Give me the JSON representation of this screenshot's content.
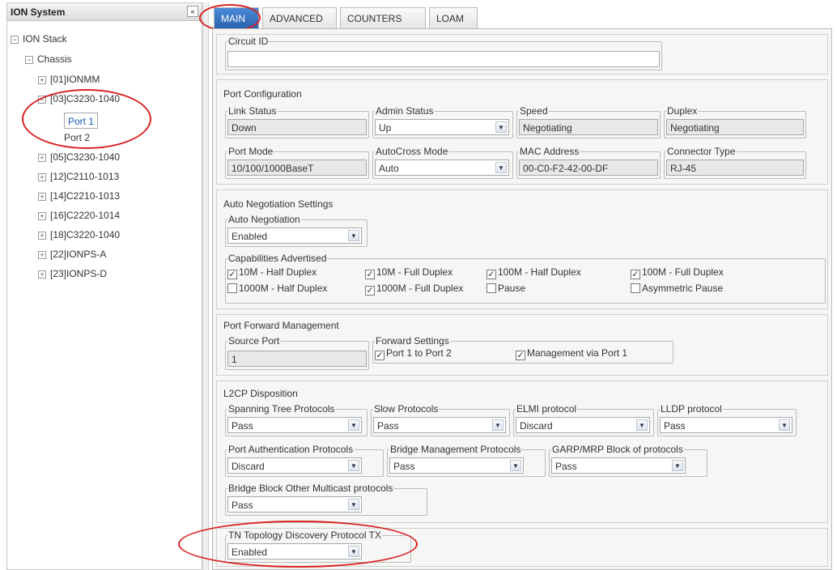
{
  "tree": {
    "title": "ION System",
    "collapse_glyph": "«",
    "nodes": [
      {
        "label": "ION Stack",
        "toggle": "−"
      },
      {
        "label": "Chassis",
        "toggle": "−"
      },
      {
        "label": "[01]IONMM",
        "toggle": "+"
      },
      {
        "label": "[03]C3230-1040",
        "toggle": "−"
      },
      {
        "label": "Port 1",
        "toggle": ""
      },
      {
        "label": "Port 2",
        "toggle": ""
      },
      {
        "label": "[05]C3230-1040",
        "toggle": "+"
      },
      {
        "label": "[12]C2110-1013",
        "toggle": "+"
      },
      {
        "label": "[14]C2210-1013",
        "toggle": "+"
      },
      {
        "label": "[16]C2220-1014",
        "toggle": "+"
      },
      {
        "label": "[18]C3220-1040",
        "toggle": "+"
      },
      {
        "label": "[22]IONPS-A",
        "toggle": "+"
      },
      {
        "label": "[23]IONPS-D",
        "toggle": "+"
      }
    ]
  },
  "tabs": [
    "MAIN",
    "ADVANCED",
    "COUNTERS",
    "LOAM"
  ],
  "circuit": {
    "label": "Circuit ID",
    "value": ""
  },
  "port_config": {
    "title": "Port Configuration",
    "link_status": {
      "label": "Link Status",
      "value": "Down"
    },
    "admin_status": {
      "label": "Admin Status",
      "value": "Up"
    },
    "speed": {
      "label": "Speed",
      "value": "Negotiating"
    },
    "duplex": {
      "label": "Duplex",
      "value": "Negotiating"
    },
    "port_mode": {
      "label": "Port Mode",
      "value": "10/100/1000BaseT"
    },
    "autocross": {
      "label": "AutoCross Mode",
      "value": "Auto"
    },
    "mac": {
      "label": "MAC Address",
      "value": "00-C0-F2-42-00-DF"
    },
    "connector": {
      "label": "Connector Type",
      "value": "RJ-45"
    }
  },
  "autoneg": {
    "title": "Auto Negotiation Settings",
    "field": {
      "label": "Auto Negotiation",
      "value": "Enabled"
    },
    "caps_label": "Capabilities Advertised",
    "caps": [
      {
        "label": "10M - Half Duplex",
        "checked": true
      },
      {
        "label": "10M - Full Duplex",
        "checked": true
      },
      {
        "label": "100M - Half Duplex",
        "checked": true
      },
      {
        "label": "100M - Full Duplex",
        "checked": true
      },
      {
        "label": "1000M - Half Duplex",
        "checked": false
      },
      {
        "label": "1000M - Full Duplex",
        "checked": true
      },
      {
        "label": "Pause",
        "checked": false
      },
      {
        "label": "Asymmetric Pause",
        "checked": false
      }
    ]
  },
  "forward": {
    "title": "Port Forward Management",
    "source": {
      "label": "Source Port",
      "value": "1"
    },
    "settings_label": "Forward Settings",
    "opt1": {
      "label": "Port 1 to Port 2",
      "checked": true
    },
    "opt2": {
      "label": "Management via Port 1",
      "checked": true
    }
  },
  "l2cp": {
    "title": "L2CP Disposition",
    "stp": {
      "label": "Spanning Tree Protocols",
      "value": "Pass"
    },
    "slow": {
      "label": "Slow Protocols",
      "value": "Pass"
    },
    "elmi": {
      "label": "ELMI protocol",
      "value": "Discard"
    },
    "lldp": {
      "label": "LLDP protocol",
      "value": "Pass"
    },
    "pauth": {
      "label": "Port Authentication Protocols",
      "value": "Discard"
    },
    "bmgmt": {
      "label": "Bridge Management Protocols",
      "value": "Pass"
    },
    "garp": {
      "label": "GARP/MRP Block of protocols",
      "value": "Pass"
    },
    "bblock": {
      "label": "Bridge Block Other Multicast protocols",
      "value": "Pass"
    }
  },
  "tn": {
    "label": "TN Topology Discovery Protocol TX",
    "value": "Enabled"
  },
  "icons": {
    "dropdown": "▼",
    "check": "✓"
  },
  "colors": {
    "annotation": "#d82020",
    "active_tab": "#2a63b0",
    "selected_node": "#1a5bb5"
  }
}
